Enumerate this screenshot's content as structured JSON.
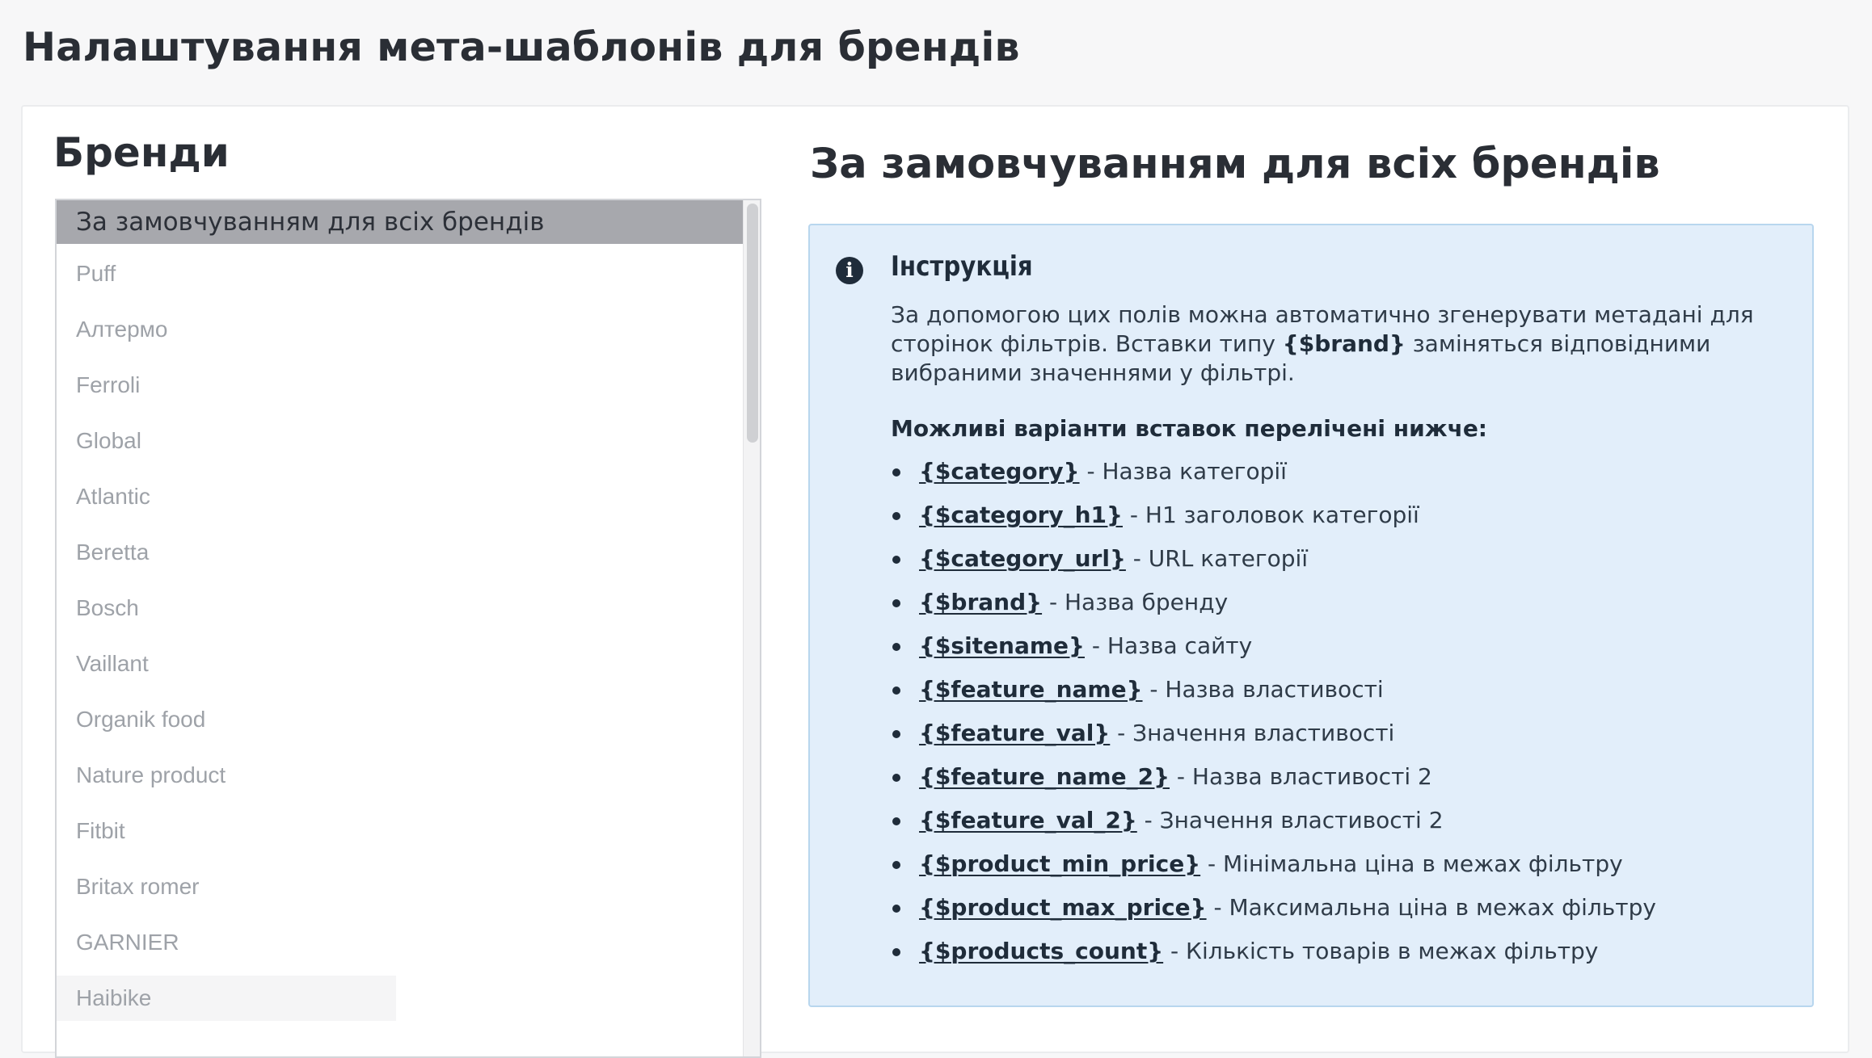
{
  "page": {
    "title": "Налаштування мета-шаблонів для брендів"
  },
  "brands": {
    "title": "Бренди",
    "items": [
      "За замовчуванням для всіх брендів",
      "Puff",
      "Алтермо",
      "Ferroli",
      "Global",
      "Atlantic",
      "Beretta",
      "Bosch",
      "Vaillant",
      "Organik food",
      "Nature product",
      "Fitbit",
      "Britax romer",
      "GARNIER",
      "Haibike"
    ],
    "selected_index": 0
  },
  "details": {
    "title": "За замовчуванням для всіх брендів",
    "instruction": {
      "icon": "info-icon",
      "title": "Інструкція",
      "text_before": "За допомогою цих полів можна автоматично згенерувати метадані для сторінок фільтрів. Вставки типу ",
      "text_code": "{$brand}",
      "text_after": " заміняться відповідними вибраними значеннями у фільтрі.",
      "variants_heading": "Можливі варіанти вставок перелічені нижче:",
      "variables": [
        {
          "code": "{$category}",
          "desc": " - Назва категорії"
        },
        {
          "code": "{$category_h1}",
          "desc": " - H1 заголовок категорії"
        },
        {
          "code": "{$category_url}",
          "desc": " - URL категорії"
        },
        {
          "code": "{$brand}",
          "desc": " - Назва бренду"
        },
        {
          "code": "{$sitename}",
          "desc": " - Назва сайту"
        },
        {
          "code": "{$feature_name}",
          "desc": " - Назва властивості"
        },
        {
          "code": "{$feature_val}",
          "desc": " - Значення властивості"
        },
        {
          "code": "{$feature_name_2}",
          "desc": " - Назва властивості 2"
        },
        {
          "code": "{$feature_val_2}",
          "desc": " - Значення властивості 2"
        },
        {
          "code": "{$product_min_price}",
          "desc": " - Мінімальна ціна в межах фільтру"
        },
        {
          "code": "{$product_max_price}",
          "desc": " - Максимальна ціна в межах фільтру"
        },
        {
          "code": "{$products_count}",
          "desc": " - Кількість товарів в межах фільтру"
        }
      ]
    }
  }
}
